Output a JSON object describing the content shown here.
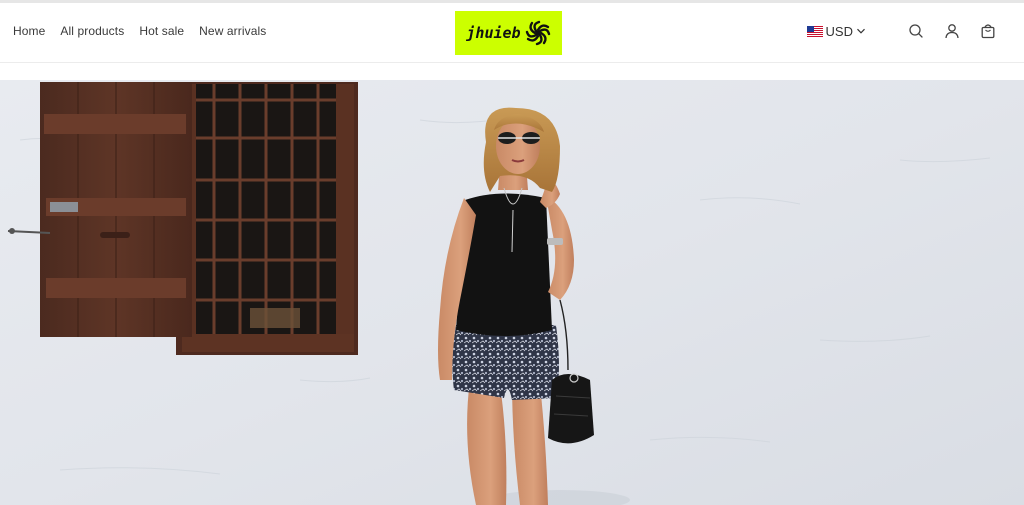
{
  "nav": {
    "items": [
      {
        "label": "Home"
      },
      {
        "label": "All products"
      },
      {
        "label": "Hot sale"
      },
      {
        "label": "New arrivals"
      }
    ]
  },
  "brand": {
    "logo_text": "jhuieb",
    "logo_bg": "#ccff00"
  },
  "header_tools": {
    "currency": "USD",
    "currency_flag": "us-flag-icon",
    "icons": [
      "search-icon",
      "account-icon",
      "cart-icon"
    ]
  },
  "hero": {
    "image": "hero-banner-image"
  }
}
